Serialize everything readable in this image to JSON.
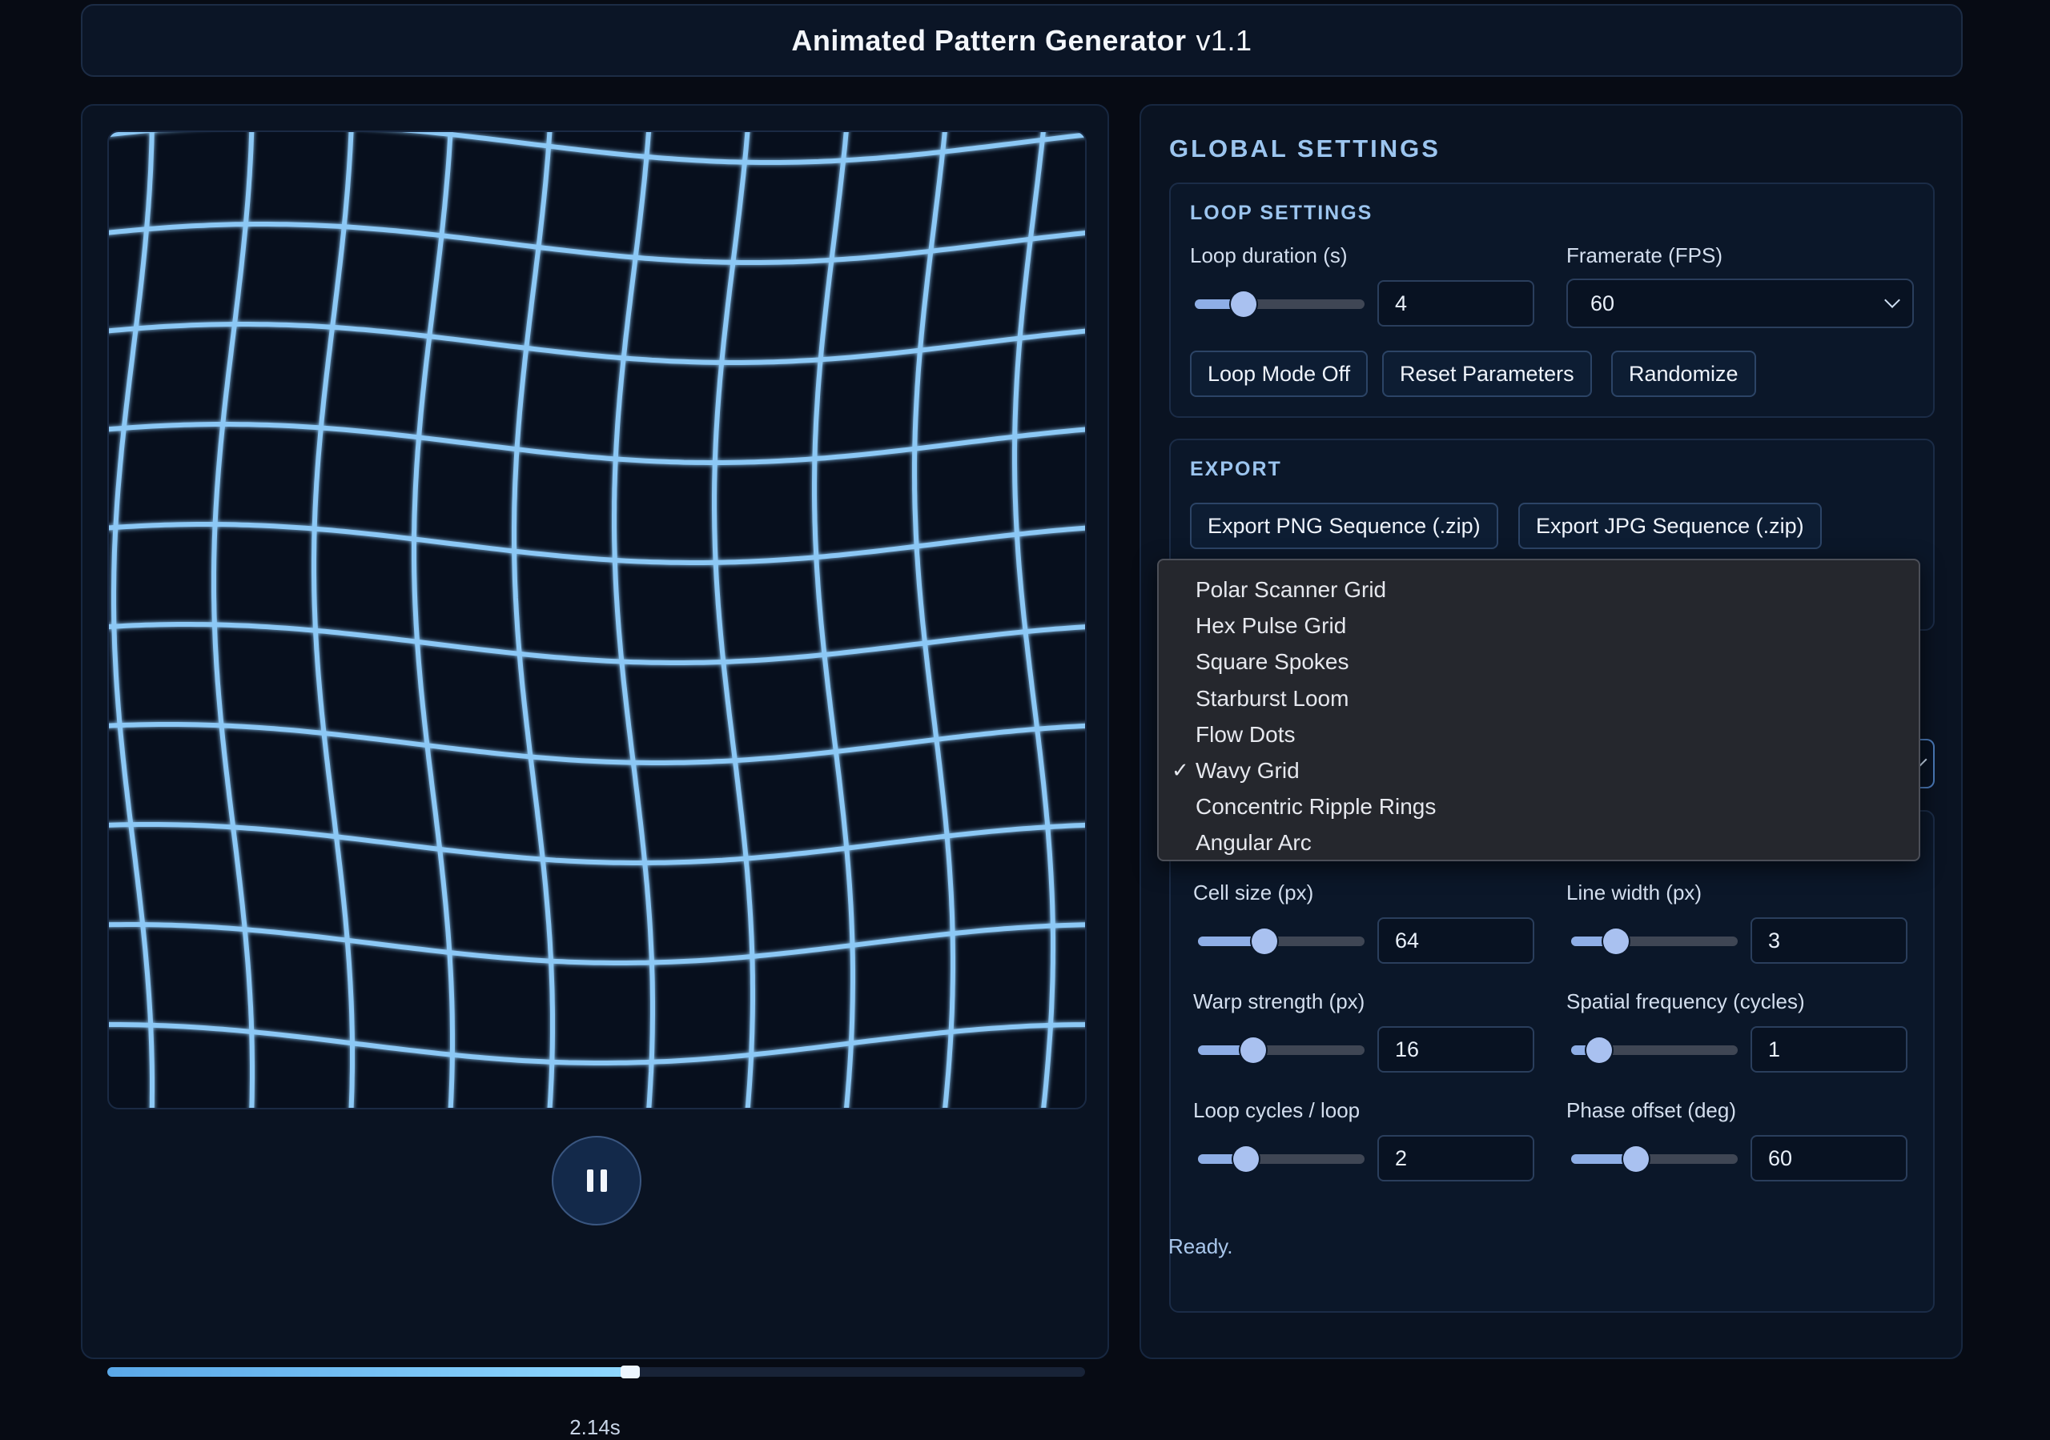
{
  "header": {
    "app_name": "Animated Pattern Generator",
    "version": "v1.1"
  },
  "preview": {
    "pattern": "Wavy Grid",
    "grid_color": "#8cc8f5",
    "playback": {
      "state": "playing",
      "button_icon": "pause-icon",
      "progress_fraction": 0.535,
      "time_label": "2.14s"
    }
  },
  "settings": {
    "title": "GLOBAL SETTINGS",
    "loop": {
      "title": "LOOP SETTINGS",
      "duration_label": "Loop duration (s)",
      "duration_value": "4",
      "duration_slider_fraction": 0.29,
      "framerate_label": "Framerate (FPS)",
      "framerate_value": "60",
      "buttons": {
        "loop_mode": "Loop Mode Off",
        "reset": "Reset Parameters",
        "randomize": "Randomize"
      }
    },
    "export": {
      "title": "EXPORT",
      "png_label": "Export PNG Sequence (.zip)",
      "jpg_label": "Export JPG Sequence (.zip)"
    },
    "pattern_dropdown": {
      "options": [
        "Polar Scanner Grid",
        "Hex Pulse Grid",
        "Square Spokes",
        "Starburst Loom",
        "Flow Dots",
        "Wavy Grid",
        "Concentric Ripple Rings",
        "Angular Arc"
      ],
      "selected_index": 5,
      "check_mark": "✓"
    },
    "params": {
      "cell_size": {
        "label": "Cell size (px)",
        "value": "64",
        "slider_fraction": 0.4
      },
      "line_width": {
        "label": "Line width (px)",
        "value": "3",
        "slider_fraction": 0.27
      },
      "warp_strength": {
        "label": "Warp strength (px)",
        "value": "16",
        "slider_fraction": 0.33
      },
      "spatial_frequency": {
        "label": "Spatial frequency (cycles)",
        "value": "1",
        "slider_fraction": 0.17
      },
      "loop_cycles": {
        "label": "Loop cycles / loop",
        "value": "2",
        "slider_fraction": 0.29
      },
      "phase_offset": {
        "label": "Phase offset (deg)",
        "value": "60",
        "slider_fraction": 0.39
      }
    },
    "status": "Ready."
  }
}
